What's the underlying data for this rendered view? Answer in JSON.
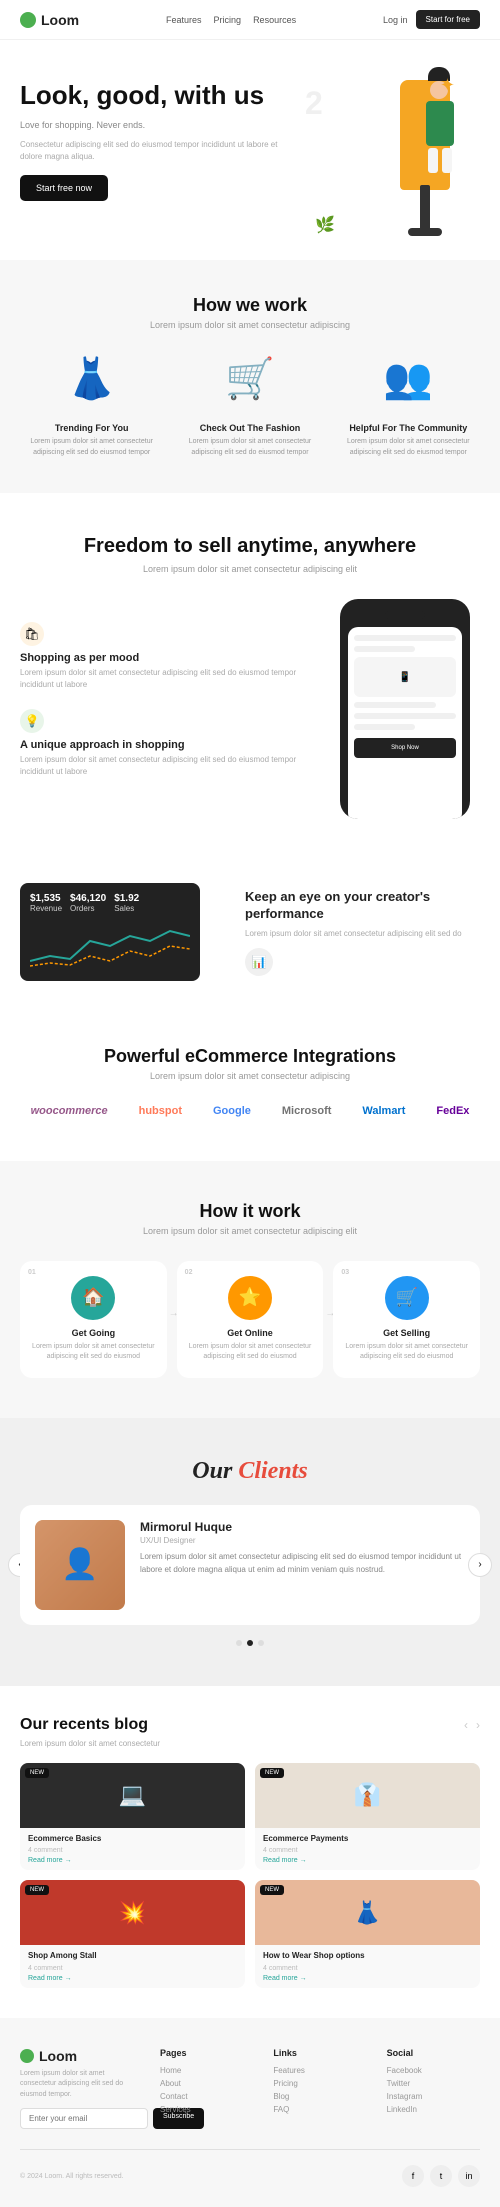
{
  "navbar": {
    "logo": "Loom",
    "links": [
      "Features",
      "Pricing",
      "Resources",
      "Log in"
    ],
    "cta": "Start for free",
    "menu_icon": "≡"
  },
  "hero": {
    "title": "Look, good, with us",
    "subtitle": "Love for shopping. Never ends.",
    "description": "Consectetur adipiscing elit sed do eiusmod tempor incididunt ut labore et dolore magna aliqua.",
    "cta": "Start free now",
    "decor_num": "2",
    "decor_star": "✦",
    "decor_plant": "🌿"
  },
  "how_we_work": {
    "title": "How we work",
    "subtitle": "Lorem ipsum dolor sit amet consectetur adipiscing",
    "cards": [
      {
        "icon": "👗",
        "title": "Trending For You",
        "text": "Lorem ipsum dolor sit amet consectetur adipiscing elit sed do eiusmod tempor"
      },
      {
        "icon": "🛒",
        "title": "Check Out The Fashion",
        "text": "Lorem ipsum dolor sit amet consectetur adipiscing elit sed do eiusmod tempor"
      },
      {
        "icon": "👥",
        "title": "Helpful For The Community",
        "text": "Lorem ipsum dolor sit amet consectetur adipiscing elit sed do eiusmod tempor"
      }
    ]
  },
  "freedom": {
    "title": "Freedom to sell anytime, anywhere",
    "subtitle": "Lorem ipsum dolor sit amet consectetur adipiscing elit",
    "features": [
      {
        "icon": "🛍",
        "icon_class": "yellow",
        "title": "Shopping as per mood",
        "text": "Lorem ipsum dolor sit amet consectetur adipiscing elit sed do eiusmod tempor incididunt ut labore"
      },
      {
        "icon": "💡",
        "icon_class": "green",
        "title": "A unique approach in shopping",
        "text": "Lorem ipsum dolor sit amet consectetur adipiscing elit sed do eiusmod tempor incididunt ut labore"
      }
    ]
  },
  "performance": {
    "title": "Keep an eye on your creator's performance",
    "subtitle": "Lorem ipsum dolor sit amet consectetur adipiscing elit sed do",
    "stats": [
      {
        "label": "Revenue",
        "value": "$1,535"
      },
      {
        "label": "Orders",
        "value": "$46,120"
      },
      {
        "label": "Sales",
        "value": "$1.92"
      }
    ]
  },
  "integrations": {
    "title": "Powerful eCommerce Integrations",
    "subtitle": "Lorem ipsum dolor sit amet consectetur adipiscing",
    "brands": [
      {
        "name": "woocommerce",
        "label": "woocommerce",
        "class": "woo"
      },
      {
        "name": "hubspot",
        "label": "hubspot",
        "class": "hub"
      },
      {
        "name": "google",
        "label": "Google",
        "class": "goo"
      },
      {
        "name": "microsoft",
        "label": "Microsoft",
        "class": "mic"
      },
      {
        "name": "walmart",
        "label": "Walmart",
        "class": "wal"
      },
      {
        "name": "fedex",
        "label": "FedEx",
        "class": "fed"
      }
    ]
  },
  "how_it_work": {
    "title": "How it work",
    "subtitle": "Lorem ipsum dolor sit amet consectetur adipiscing elit",
    "steps": [
      {
        "num": "01",
        "icon": "🏠",
        "icon_class": "teal",
        "title": "Get Going",
        "text": "Lorem ipsum dolor sit amet consectetur adipiscing elit sed do eiusmod"
      },
      {
        "num": "02",
        "icon": "⭐",
        "icon_class": "orange",
        "title": "Get Online",
        "text": "Lorem ipsum dolor sit amet consectetur adipiscing elit sed do eiusmod"
      },
      {
        "num": "03",
        "icon": "🛒",
        "icon_class": "blue",
        "title": "Get Selling",
        "text": "Lorem ipsum dolor sit amet consectetur adipiscing elit sed do eiusmod"
      }
    ]
  },
  "clients": {
    "title": "Our Clients",
    "testimonial": {
      "name": "Mirmorul Huque",
      "role": "UX/UI Designer",
      "text": "Lorem ipsum dolor sit amet consectetur adipiscing elit sed do eiusmod tempor incididunt ut labore et dolore magna aliqua ut enim ad minim veniam quis nostrud.",
      "avatar_emoji": "👤"
    },
    "dots": [
      false,
      true,
      false
    ]
  },
  "blog": {
    "title": "Our recents blog",
    "subtitle": "Lorem ipsum dolor sit amet consectetur",
    "nav_prev": "‹",
    "nav_next": "›",
    "posts": [
      {
        "badge": "NEW",
        "img_class": "dark",
        "emoji": "💻",
        "title": "Ecommerce Basics",
        "meta": "4 comment",
        "read_more": "Read more →"
      },
      {
        "badge": "NEW",
        "img_class": "light",
        "emoji": "👔",
        "title": "Ecommerce Payments",
        "meta": "4 comment",
        "read_more": "Read more →"
      },
      {
        "badge": "NEW",
        "img_class": "red",
        "emoji": "💥",
        "title": "Shop Among Stall",
        "meta": "4 comment",
        "read_more": "Read more →"
      },
      {
        "badge": "NEW",
        "img_class": "peach",
        "emoji": "👗",
        "title": "How to Wear Shop options",
        "meta": "4 comment",
        "read_more": "Read more →"
      }
    ]
  },
  "footer": {
    "logo": "Loom",
    "tagline": "Lorem ipsum dolor sit amet consectetur adipiscing elit sed do eiusmod tempor.",
    "newsletter_placeholder": "Enter your email",
    "subscribe_label": "Subscribe",
    "columns": [
      {
        "title": "Pages",
        "items": [
          "Home",
          "About",
          "Contact",
          "Services"
        ]
      },
      {
        "title": "Links",
        "items": [
          "Features",
          "Pricing",
          "Blog",
          "FAQ"
        ]
      },
      {
        "title": "Social",
        "items": [
          "Facebook",
          "Twitter",
          "Instagram",
          "LinkedIn"
        ]
      }
    ],
    "copyright": "© 2024 Loom. All rights reserved.",
    "social_icons": [
      "f",
      "t",
      "in"
    ]
  }
}
